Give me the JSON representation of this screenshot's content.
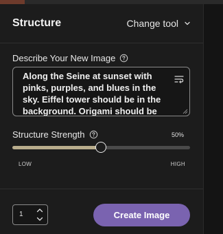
{
  "header": {
    "title": "Structure",
    "change_tool_label": "Change tool"
  },
  "prompt": {
    "label": "Describe Your New Image",
    "text": "Along the Seine at sunset with pinks, purples, and blues in the sky. Eiffel tower should be in the background. Origami should be"
  },
  "structure_strength": {
    "label": "Structure Strength",
    "value_label": "50%",
    "value": 0.5,
    "low_label": "LOW",
    "high_label": "HIGH"
  },
  "quantity": {
    "value": "1"
  },
  "create_button": {
    "label": "Create Image"
  },
  "colors": {
    "accent_button": "#7a63b0",
    "slider_fill": "#b9ad8d",
    "panel_bg": "#1c1c1c"
  },
  "icons": {
    "change_tool": "chevron-down-icon",
    "help": "help-circle-icon",
    "wrap": "text-wrap-icon",
    "stepper_up": "chevron-up-icon",
    "stepper_down": "chevron-down-icon"
  }
}
